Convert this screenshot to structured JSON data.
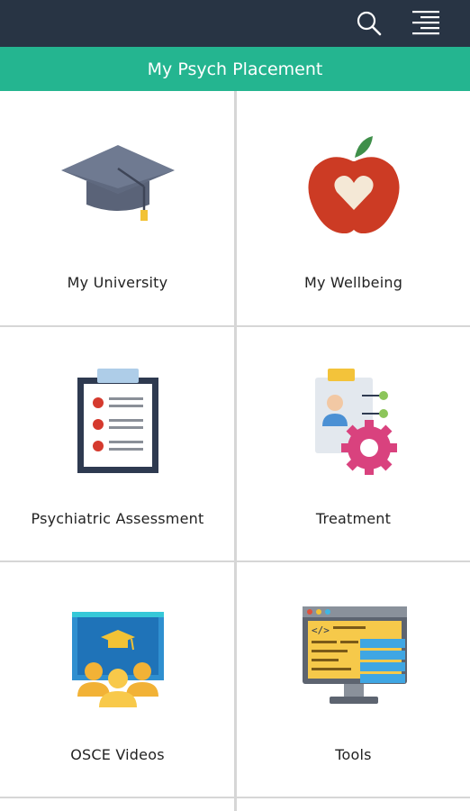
{
  "header": {
    "search_icon": "search-icon",
    "menu_icon": "menu-icon",
    "colors": {
      "topbar": "#283444",
      "titlebar": "#24b590"
    }
  },
  "title": "My Psych Placement",
  "tiles": [
    {
      "label": "My University",
      "icon": "graduation-cap-icon"
    },
    {
      "label": "My Wellbeing",
      "icon": "apple-heart-icon"
    },
    {
      "label": "Psychiatric Assessment",
      "icon": "clipboard-icon"
    },
    {
      "label": "Treatment",
      "icon": "treatment-gear-icon"
    },
    {
      "label": "OSCE Videos",
      "icon": "video-class-icon"
    },
    {
      "label": "Tools",
      "icon": "code-monitor-icon"
    }
  ]
}
